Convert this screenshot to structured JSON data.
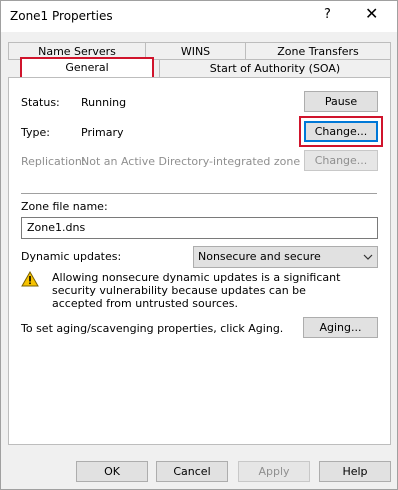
{
  "window": {
    "title": "Zone1 Properties",
    "help_glyph": "?",
    "close_glyph": "✕"
  },
  "tabs": {
    "row1": [
      "Name Servers",
      "WINS",
      "Zone Transfers"
    ],
    "row2": [
      "General",
      "Start of Authority (SOA)"
    ],
    "active": "General"
  },
  "general": {
    "status_label": "Status:",
    "status_value": "Running",
    "pause_button": "Pause",
    "type_label": "Type:",
    "type_value": "Primary",
    "change_type_button": "Change...",
    "replication_label": "Replication:",
    "replication_value": "Not an Active Directory-integrated zone",
    "change_replication_button": "Change...",
    "zone_file_label": "Zone file name:",
    "zone_file_value": "Zone1.dns",
    "dynamic_updates_label": "Dynamic updates:",
    "dynamic_updates_value": "Nonsecure and secure",
    "warning_text": "Allowing nonsecure dynamic updates is a significant security vulnerability because updates can be accepted from untrusted sources.",
    "aging_text": "To set aging/scavenging properties, click Aging.",
    "aging_button": "Aging..."
  },
  "footer": {
    "ok": "OK",
    "cancel": "Cancel",
    "apply": "Apply",
    "help": "Help"
  },
  "colors": {
    "highlight_red": "#d0142c",
    "focus_blue": "#0078d7",
    "warning_yellow": "#f6c200"
  },
  "icons": {
    "warning": "warning-icon",
    "dropdown": "chevron-down-icon",
    "help": "help-icon",
    "close": "close-icon"
  }
}
